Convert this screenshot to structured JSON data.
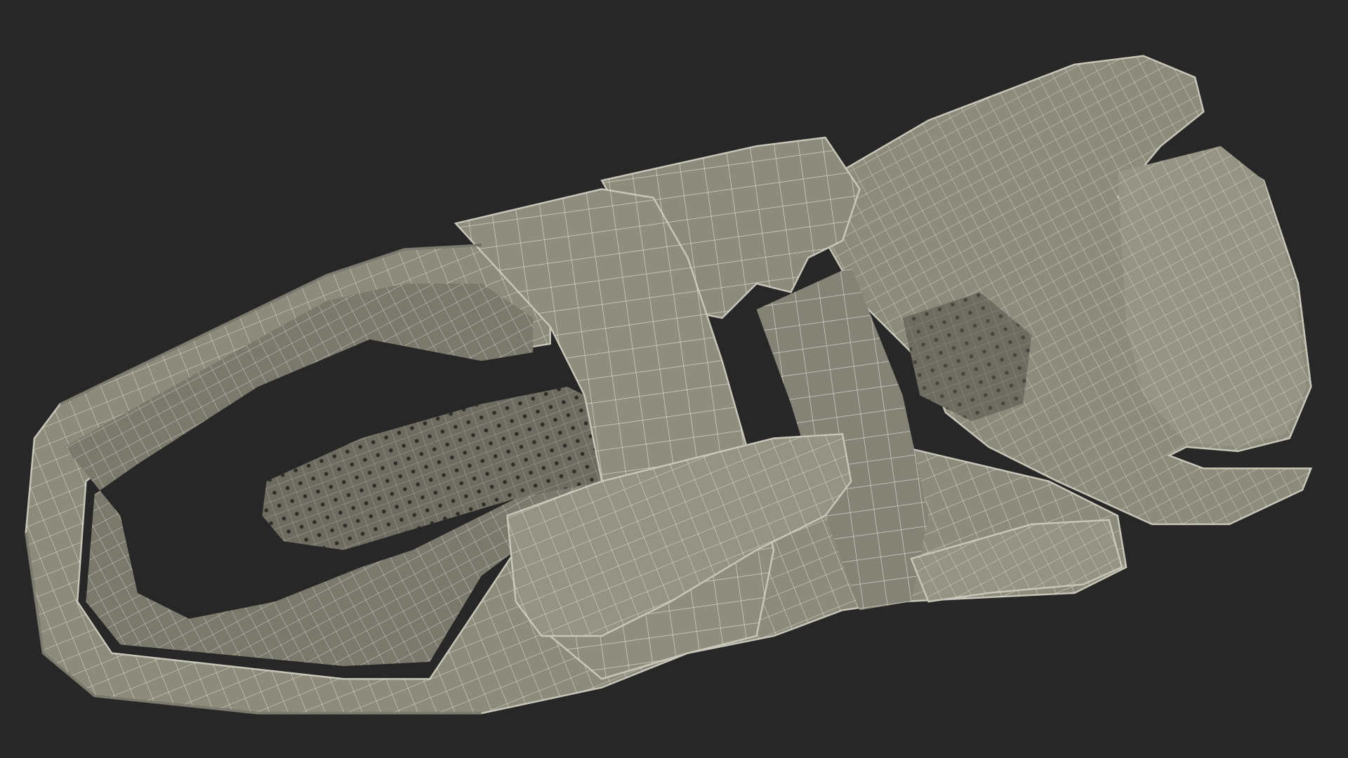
{
  "scene": {
    "background_color": "#272727",
    "model_fill_color": "#8d8b7c",
    "model_shadow_color": "#5f5e53",
    "model_highlight_color": "#a3a193",
    "wire_color": "#e9e8dd"
  }
}
